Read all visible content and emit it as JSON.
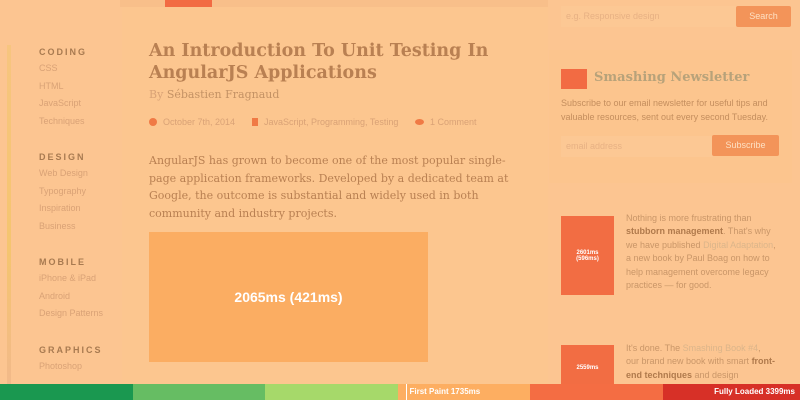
{
  "sidebar": {
    "groups": [
      {
        "title": "CODING",
        "items": [
          "CSS",
          "HTML",
          "JavaScript",
          "Techniques"
        ]
      },
      {
        "title": "DESIGN",
        "items": [
          "Web Design",
          "Typography",
          "Inspiration",
          "Business"
        ]
      },
      {
        "title": "MOBILE",
        "items": [
          "iPhone & iPad",
          "Android",
          "Design Patterns"
        ]
      },
      {
        "title": "GRAPHICS",
        "items": [
          "Photoshop"
        ]
      }
    ]
  },
  "article": {
    "title": "An Introduction To Unit Testing In AngularJS Applications",
    "by": "By",
    "author": "Sébastien Fragnaud",
    "date": "October 7th, 2014",
    "tags": "JavaScript, Programming, Testing",
    "comments": "1 Comment",
    "lead": "AngularJS has grown to become one of the most popular single-page application frameworks. Developed by a dedicated team at Google, the outcome is substantial and widely used in both community and industry projects.",
    "image_timing": "2065ms (421ms)"
  },
  "search": {
    "placeholder": "e.g. Responsive design",
    "button": "Search"
  },
  "newsletter": {
    "title": "Smashing Newsletter",
    "text": "Subscribe to our email newsletter for useful tips and valuable resources, sent out every second Tuesday.",
    "placeholder": "email address",
    "button": "Subscribe"
  },
  "ads": [
    {
      "timing": "2601ms (596ms)",
      "t1": "Nothing is more frustrating than ",
      "b1": "stubborn management",
      "t2": ". That's why we have published ",
      "link": "Digital Adaptation",
      "t3": ", a new book by Paul Boag on how to help management overcome legacy practices — for good."
    },
    {
      "timing": "2559ms",
      "t1": "It's done. The ",
      "link": "Smashing Book #4",
      "t2": ", our brand new book with smart ",
      "b1": "front-end techniques",
      "t3": " and design approaches."
    }
  ],
  "timeline": {
    "first_paint": "First Paint 1735ms",
    "fully_loaded": "Fully Loaded 3399ms",
    "colors": [
      "#1a9850",
      "#66bd63",
      "#a6d96a",
      "#fdae61",
      "#f46d43",
      "#d73027"
    ]
  }
}
